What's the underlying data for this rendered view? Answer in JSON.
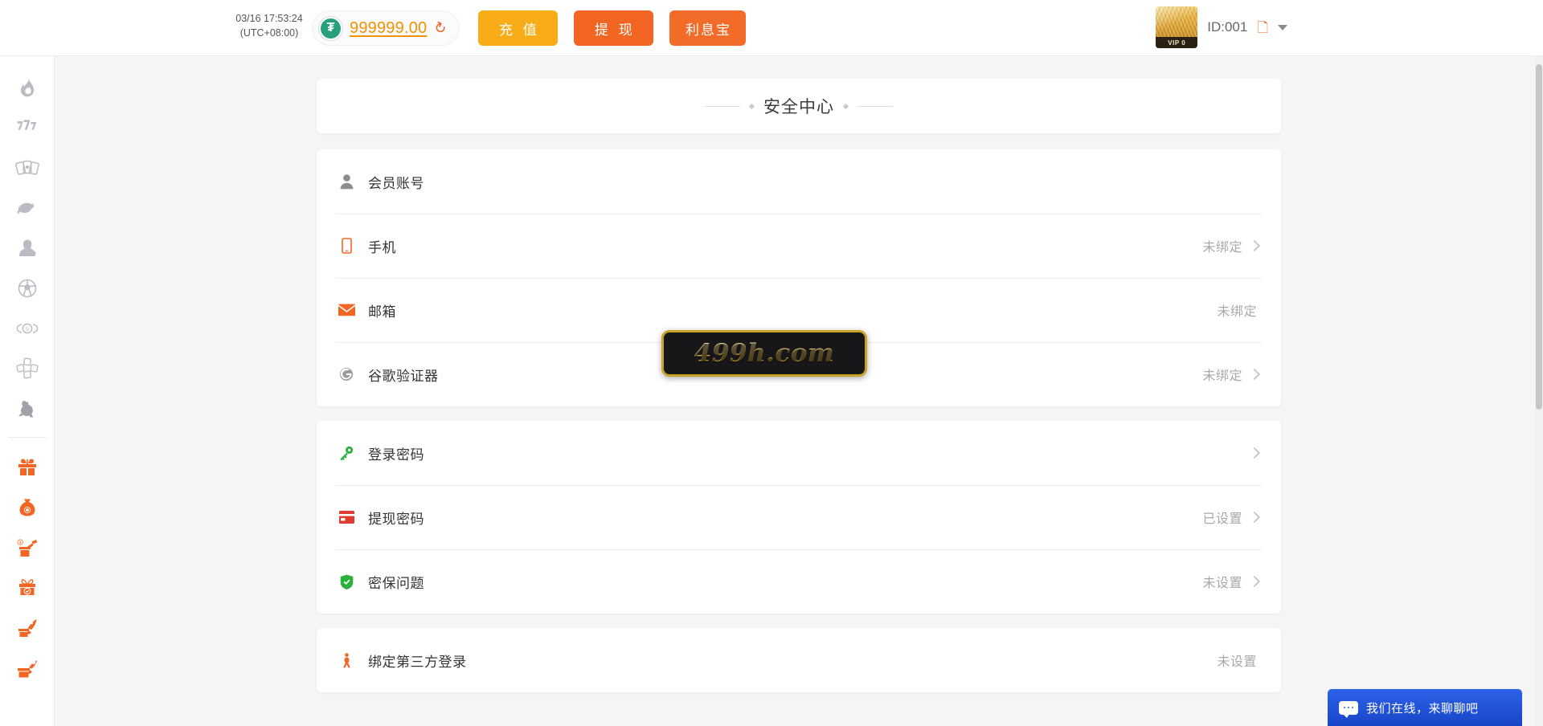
{
  "topbar": {
    "datetime_line1": "03/16 17:53:24",
    "datetime_line2": "(UTC+08:00)",
    "coin_symbol": "₮",
    "balance": "999999.00",
    "refresh_icon": "refresh-icon",
    "buttons": [
      {
        "label": "充 值",
        "name": "recharge-button",
        "color": "#f8ac18"
      },
      {
        "label": "提 现",
        "name": "withdraw-button",
        "color": "#f26522"
      },
      {
        "label": "利息宝",
        "name": "interest-treasure-button",
        "color": "#f26b28"
      }
    ],
    "user": {
      "vip_badge": "VIP 0",
      "id_text": "ID:001",
      "copy_icon": "copy-icon",
      "caret_icon": "chevron-down-icon"
    }
  },
  "sidebar": {
    "items": [
      {
        "name": "sidebar-item-hot",
        "icon": "flame-icon"
      },
      {
        "name": "sidebar-item-slots",
        "icon": "slot-777-icon"
      },
      {
        "name": "sidebar-item-cards",
        "icon": "playing-cards-icon"
      },
      {
        "name": "sidebar-item-fishing",
        "icon": "fish-icon"
      },
      {
        "name": "sidebar-item-live",
        "icon": "live-dealer-icon"
      },
      {
        "name": "sidebar-item-sports",
        "icon": "soccer-ball-icon"
      },
      {
        "name": "sidebar-item-lottery",
        "icon": "lottery-ball-icon"
      },
      {
        "name": "sidebar-item-dice",
        "icon": "dice-icon"
      },
      {
        "name": "sidebar-item-cockfight",
        "icon": "rooster-icon"
      }
    ],
    "promo_items": [
      {
        "name": "sidebar-item-gift",
        "icon": "gift-box-icon"
      },
      {
        "name": "sidebar-item-money-bag",
        "icon": "money-bag-icon"
      },
      {
        "name": "sidebar-item-bonus",
        "icon": "gift-money-icon"
      },
      {
        "name": "sidebar-item-checkin",
        "icon": "gift-check-icon"
      },
      {
        "name": "sidebar-item-rocket-gift",
        "icon": "rocket-gift-icon"
      },
      {
        "name": "sidebar-item-share-gift",
        "icon": "share-gift-icon"
      }
    ]
  },
  "page": {
    "title": "安全中心"
  },
  "cards": [
    {
      "name": "account-security-card",
      "rows": [
        {
          "name": "row-member-account",
          "icon": "user-icon",
          "label": "会员账号",
          "status": "",
          "chevron": false
        },
        {
          "name": "row-phone",
          "icon": "phone-icon",
          "label": "手机",
          "status": "未绑定",
          "chevron": true
        },
        {
          "name": "row-email",
          "icon": "envelope-icon",
          "label": "邮箱",
          "status": "未绑定",
          "chevron": false
        },
        {
          "name": "row-google-auth",
          "icon": "google-auth-icon",
          "label": "谷歌验证器",
          "status": "未绑定",
          "chevron": true
        }
      ]
    },
    {
      "name": "password-security-card",
      "rows": [
        {
          "name": "row-login-password",
          "icon": "key-icon",
          "label": "登录密码",
          "status": "",
          "chevron": true
        },
        {
          "name": "row-withdraw-password",
          "icon": "credit-card-icon",
          "label": "提现密码",
          "status": "已设置",
          "chevron": true
        },
        {
          "name": "row-security-question",
          "icon": "shield-check-icon",
          "label": "密保问题",
          "status": "未设置",
          "chevron": true
        }
      ]
    },
    {
      "name": "third-party-card",
      "rows": [
        {
          "name": "row-bind-third-party",
          "icon": "third-party-icon",
          "label": "绑定第三方登录",
          "status": "未设置",
          "chevron": false
        }
      ]
    }
  ],
  "watermark": {
    "text": "499h.com"
  },
  "chat": {
    "label": "我们在线，来聊聊吧",
    "icon": "chat-bubble-icon"
  },
  "colors": {
    "orange": "#f26522",
    "amber": "#f8ac18",
    "green": "#2db13c",
    "red": "#e03b2f",
    "gold": "#c9a227"
  }
}
